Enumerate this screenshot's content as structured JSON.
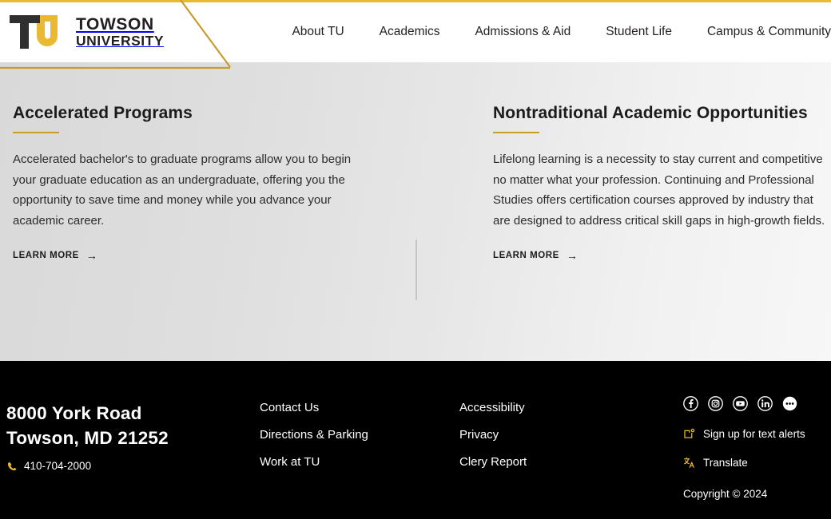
{
  "theme": {
    "gold": "#e8b931",
    "gold_dark": "#c99b2e",
    "ink": "#231f20",
    "footer_bg": "#000000",
    "content_bg_left": "#d9d9d9",
    "content_bg_right": "#f7f7f7"
  },
  "header": {
    "logo": {
      "mark_name": "tu-monogram",
      "line1": "TOWSON",
      "line2": "UNIVERSITY"
    },
    "nav": [
      {
        "label": "About TU"
      },
      {
        "label": "Academics"
      },
      {
        "label": "Admissions & Aid"
      },
      {
        "label": "Student Life"
      },
      {
        "label": "Campus & Community"
      }
    ]
  },
  "main": {
    "columns": [
      {
        "title": "Accelerated Programs",
        "body": "Accelerated bachelor's to graduate programs allow you to begin your graduate education as an undergraduate, offering you the opportunity to save time and money while you advance your academic career.",
        "cta": "LEARN MORE",
        "cta_arrow": "→"
      },
      {
        "title": "Nontraditional Academic Opportunities",
        "body": "Lifelong learning is a necessity to stay current and competitive no matter what your profession. Continuing and Professional Studies offers certification courses approved by industry that are designed to address critical skill gaps in high-growth fields.",
        "cta": "LEARN MORE",
        "cta_arrow": "→"
      }
    ]
  },
  "footer": {
    "address": {
      "line1": "8000 York Road",
      "line2": "Towson, MD 21252"
    },
    "phone": {
      "icon": "phone-icon",
      "number": "410-704-2000"
    },
    "links_column_1": [
      {
        "label": "Contact Us"
      },
      {
        "label": "Directions & Parking"
      },
      {
        "label": "Work at TU"
      }
    ],
    "links_column_2": [
      {
        "label": "Accessibility"
      },
      {
        "label": "Privacy"
      },
      {
        "label": "Clery Report"
      }
    ],
    "social": [
      {
        "name": "facebook-icon"
      },
      {
        "name": "instagram-icon"
      },
      {
        "name": "youtube-icon"
      },
      {
        "name": "linkedin-icon"
      },
      {
        "name": "more-ellipsis-icon"
      }
    ],
    "text_alerts": {
      "icon": "text-alert-icon",
      "label": "Sign up for text alerts"
    },
    "translate": {
      "icon": "translate-icon",
      "label": "Translate"
    },
    "copyright": "Copyright  © 2024"
  }
}
